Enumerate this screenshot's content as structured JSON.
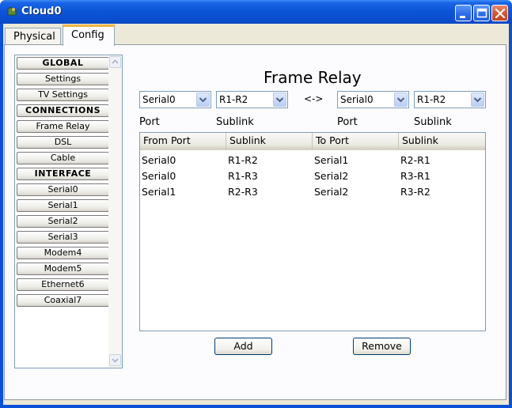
{
  "window": {
    "title": "Cloud0"
  },
  "tabs": [
    {
      "label": "Physical",
      "active": false
    },
    {
      "label": "Config",
      "active": true
    }
  ],
  "sidebar": {
    "items": [
      {
        "label": "GLOBAL",
        "header": true
      },
      {
        "label": "Settings"
      },
      {
        "label": "TV Settings"
      },
      {
        "label": "CONNECTIONS",
        "header": true
      },
      {
        "label": "Frame Relay"
      },
      {
        "label": "DSL"
      },
      {
        "label": "Cable"
      },
      {
        "label": "INTERFACE",
        "header": true
      },
      {
        "label": "Serial0"
      },
      {
        "label": "Serial1"
      },
      {
        "label": "Serial2"
      },
      {
        "label": "Serial3"
      },
      {
        "label": "Modem4"
      },
      {
        "label": "Modem5"
      },
      {
        "label": "Ethernet6"
      },
      {
        "label": "Coaxial7"
      }
    ]
  },
  "main": {
    "title": "Frame Relay",
    "from_port_select": "Serial0",
    "from_sublink_select": "R1-R2",
    "swap_symbol": "<->",
    "to_port_select": "Serial0",
    "to_sublink_select": "R1-R2",
    "labels": {
      "port": "Port",
      "sublink": "Sublink"
    },
    "table": {
      "columns": [
        "From Port",
        "Sublink",
        "To Port",
        "Sublink"
      ],
      "rows": [
        [
          "Serial0",
          "R1-R2",
          "Serial1",
          "R2-R1"
        ],
        [
          "Serial0",
          "R1-R3",
          "Serial2",
          "R3-R1"
        ],
        [
          "Serial1",
          "R2-R3",
          "Serial2",
          "R3-R2"
        ]
      ]
    },
    "add_label": "Add",
    "remove_label": "Remove"
  },
  "colors": {
    "titlebar": "#0a50d8",
    "client_bg": "#ece9d8",
    "tab_accent": "#f0b543",
    "close_button": "#d7532e"
  },
  "icons": {
    "app": "cloud-icon",
    "minimize": "minimize-icon",
    "maximize": "maximize-icon",
    "close": "close-icon",
    "dropdown": "chevron-down-icon"
  }
}
